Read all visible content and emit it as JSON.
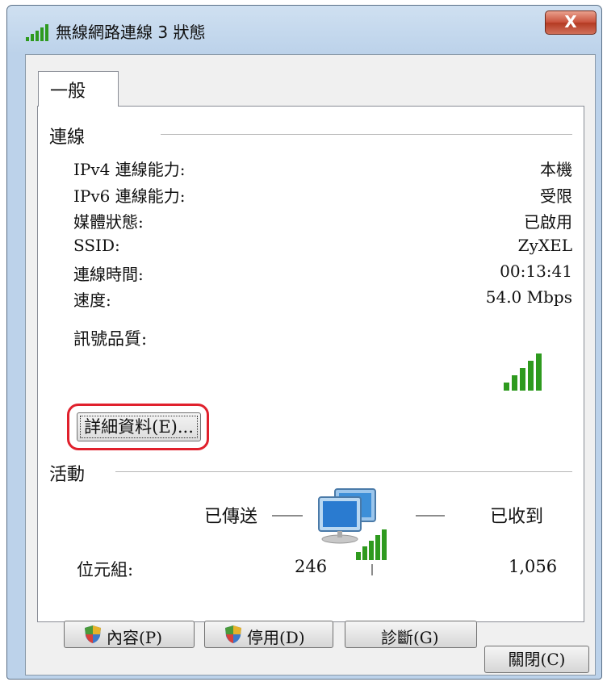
{
  "window": {
    "title": "無線網路連線 3 狀態",
    "close_glyph": "X"
  },
  "tab": {
    "label": "一般"
  },
  "connection": {
    "heading": "連線",
    "rows": [
      {
        "label": "IPv4 連線能力:",
        "value": "本機"
      },
      {
        "label": "IPv6 連線能力:",
        "value": "受限"
      },
      {
        "label": "媒體狀態:",
        "value": "已啟用"
      },
      {
        "label": "SSID:",
        "value": "ZyXEL"
      },
      {
        "label": "連線時間:",
        "value": "00:13:41"
      },
      {
        "label": "速度:",
        "value": "54.0 Mbps"
      }
    ],
    "signal_label": "訊號品質:",
    "signal_icon": "signal-strength-icon",
    "details_button": "詳細資料(E)..."
  },
  "activity": {
    "heading": "活動",
    "sent_label": "已傳送",
    "received_label": "已收到",
    "bytes_label": "位元組:",
    "bytes_sent": "246",
    "bytes_received": "1,056"
  },
  "buttons": {
    "properties": "內容(P)",
    "disable": "停用(D)",
    "diagnose": "診斷(G)",
    "close": "關閉(C)"
  },
  "colors": {
    "highlight": "#e0202c",
    "signal_green": "#2e9a1e",
    "title_bar": "#c4d8ee"
  }
}
